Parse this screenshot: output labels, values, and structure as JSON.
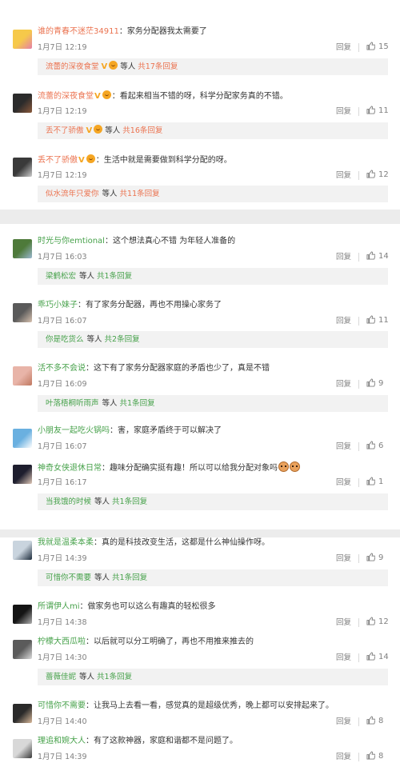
{
  "like_label": "回复",
  "colors": {
    "orange_name": "#eb7350",
    "green_name": "#46a14a",
    "page_bg": "#ececec",
    "sub_bg": "#f2f2f2"
  },
  "groups": [
    {
      "comments": [
        {
          "user": "谁的青春不迷茫34911",
          "name_color": "orange",
          "sep": "：",
          "text": "家务分配器我太需要了",
          "time": "1月7日 12:19",
          "reply": "回复",
          "likes": "15",
          "avatar_colors": [
            "#f6c94a",
            "#e57fa8"
          ],
          "sub": {
            "user": "流蕾的深夜食堂",
            "vip": "V",
            "badge": true,
            "mid": "等人",
            "count": "共17条回复"
          }
        },
        {
          "user": "流蕾的深夜食堂",
          "name_color": "orange",
          "vip": "V",
          "badge": true,
          "sep": "：",
          "text": "看起来相当不错的呀，科学分配家务真的不错。",
          "time": "1月7日 12:19",
          "reply": "回复",
          "likes": "11",
          "avatar_colors": [
            "#2b2b2b",
            "#8b5a3c"
          ],
          "sub": {
            "user": "丢不了骄傲",
            "vip": "V",
            "badge": true,
            "mid": "等人",
            "count": "共16条回复"
          }
        },
        {
          "user": "丢不了骄傲",
          "name_color": "orange",
          "vip": "V",
          "badge": true,
          "sep": "：",
          "text": "生活中就是需要做到科学分配的呀。",
          "time": "1月7日 12:19",
          "reply": "回复",
          "likes": "12",
          "avatar_colors": [
            "#3a3a3a",
            "#ccc"
          ],
          "sub": {
            "user": "似水流年只爱你",
            "mid": "等人",
            "count": "共11条回复"
          }
        }
      ]
    },
    {
      "comments": [
        {
          "user": "时光与你emtional",
          "name_color": "green",
          "sep": "：",
          "text": "这个想法真心不错 为年轻人准备的",
          "time": "1月7日 16:03",
          "reply": "回复",
          "likes": "14",
          "avatar_colors": [
            "#4e7a3a",
            "#9bb8d0"
          ],
          "sub": {
            "user": "梁鹤松宏",
            "mid": "等人",
            "count": "共1条回复"
          }
        },
        {
          "user": "乖巧小妹子",
          "name_color": "green",
          "sep": "：",
          "text": "有了家务分配器，再也不用操心家务了",
          "time": "1月7日 16:07",
          "reply": "回复",
          "likes": "11",
          "avatar_colors": [
            "#5a5a5a",
            "#d8c2b0"
          ],
          "sub": {
            "user": "你是吃货么",
            "mid": "等人",
            "count": "共2条回复"
          }
        },
        {
          "user": "活不多不会说",
          "name_color": "green",
          "sep": "：",
          "text": "这下有了家务分配器家庭的矛盾也少了，真是不错",
          "time": "1月7日 16:09",
          "reply": "回复",
          "likes": "9",
          "avatar_colors": [
            "#e8b4a8",
            "#c07860"
          ],
          "sub": {
            "user": "叶落梧桐听雨声",
            "mid": "等人",
            "count": "共1条回复"
          }
        },
        {
          "user": "小朋友一起吃火锅吗",
          "name_color": "green",
          "sep": "：",
          "text": "害，家庭矛盾终于可以解决了",
          "time": "1月7日 16:07",
          "reply": "回复",
          "likes": "6",
          "avatar_colors": [
            "#6ab0e0",
            "#fff"
          ]
        },
        {
          "user": "神奇女侠退休日常",
          "name_color": "green",
          "sep": "：",
          "text": "趣味分配确实挺有趣！所以可以给我分配对象吗",
          "dogs": true,
          "time": "1月7日 16:17",
          "reply": "回复",
          "likes": "1",
          "avatar_colors": [
            "#1e1e2e",
            "#e0c8b8"
          ],
          "sub": {
            "user": "当我饿的时候",
            "mid": "等人",
            "count": "共1条回复"
          }
        }
      ]
    },
    {
      "comments": [
        {
          "user": "我就是温柔本柔",
          "name_color": "green",
          "sep": "：",
          "text": "真的是科技改变生活，这都是什么神仙操作呀。",
          "time": "1月7日 14:39",
          "reply": "回复",
          "likes": "9",
          "avatar_colors": [
            "#c9d4de",
            "#1b2a3a"
          ],
          "sub": {
            "user": "可惜你不需要",
            "mid": "等人",
            "count": "共1条回复"
          }
        },
        {
          "user": "所谓伊人mi",
          "name_color": "green",
          "sep": "：",
          "text": "做家务也可以这么有趣真的轻松很多",
          "time": "1月7日 14:38",
          "reply": "回复",
          "likes": "12",
          "avatar_colors": [
            "#141414",
            "#b0b0b0"
          ]
        },
        {
          "user": "柠檬大西瓜啦",
          "name_color": "green",
          "sep": "：",
          "text": "以后就可以分工明确了，再也不用推来推去的",
          "time": "1月7日 14:30",
          "reply": "回复",
          "likes": "14",
          "avatar_colors": [
            "#5b5b5b",
            "#dcdcdc"
          ],
          "sub": {
            "user": "蔷薇佳妮",
            "mid": "等人",
            "count": "共1条回复"
          }
        },
        {
          "user": "可惜你不需要",
          "name_color": "green",
          "sep": "：",
          "text": "让我马上去看一看，感觉真的是超级优秀，晚上都可以安排起来了。",
          "time": "1月7日 14:40",
          "reply": "回复",
          "likes": "8",
          "avatar_colors": [
            "#2a2a2a",
            "#d9b99a"
          ]
        },
        {
          "user": "理追和婉大人",
          "name_color": "green",
          "sep": "：",
          "text": "有了这款神器，家庭和谐都不是问题了。",
          "time": "1月7日 14:39",
          "reply": "回复",
          "likes": "8",
          "avatar_colors": [
            "#d8d8d8",
            "#3a3a3a"
          ]
        }
      ]
    }
  ]
}
